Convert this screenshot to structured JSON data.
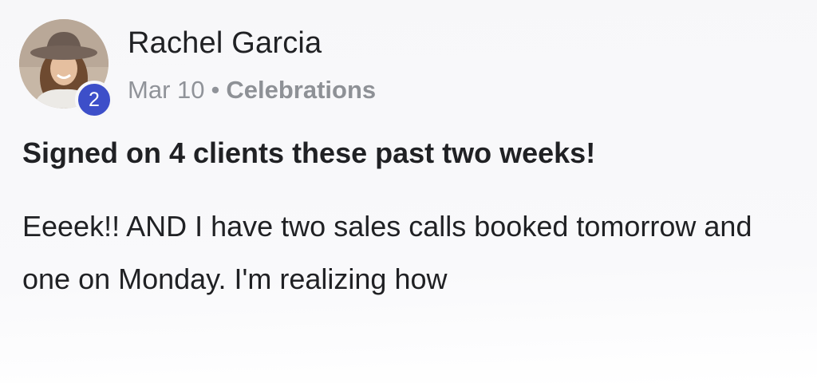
{
  "post": {
    "author": {
      "name": "Rachel Garcia",
      "level": "2",
      "avatar_icon": "user-photo"
    },
    "meta": {
      "date": "Mar 10",
      "separator": "•",
      "category": "Celebrations"
    },
    "title": "Signed on 4 clients these past two weeks!",
    "body": "Eeeek!! AND I have two sales calls booked tomorrow and one on Monday. I'm realizing how"
  },
  "colors": {
    "badge": "#3d4fc9",
    "text": "#202124",
    "muted": "#909399"
  }
}
